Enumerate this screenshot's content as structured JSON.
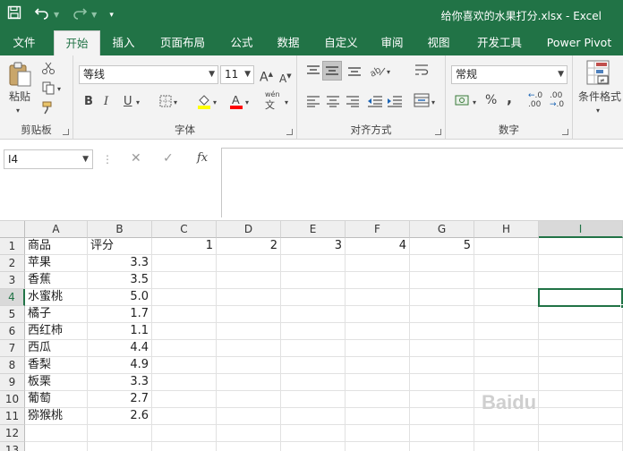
{
  "window": {
    "title": "给你喜欢的水果打分.xlsx - Excel"
  },
  "qat": {
    "save_icon": "save-icon",
    "undo_icon": "undo-icon",
    "redo_icon": "redo-icon",
    "customize_icon": "customize-qat-icon"
  },
  "tabs": [
    "文件",
    "开始",
    "插入",
    "页面布局",
    "公式",
    "数据",
    "审阅",
    "视图",
    "开发工具",
    "Power Pivot"
  ],
  "tabs_extra": "自定义",
  "ribbon": {
    "clipboard": {
      "label": "剪贴板",
      "paste": "粘贴"
    },
    "font": {
      "label": "字体",
      "name": "等线",
      "size": "11",
      "bold": "B",
      "italic": "I",
      "underline": "U",
      "grow": "A",
      "shrink": "A",
      "wen": "wén"
    },
    "alignment": {
      "label": "对齐方式"
    },
    "number": {
      "label": "数字",
      "format": "常规",
      "percent": "%",
      "comma": ",",
      "inc_dec": ".0",
      "dec_dec": ".00"
    },
    "styles": {
      "conditional": "条件格式"
    }
  },
  "formula_bar": {
    "name_box": "I4",
    "fx": "fx",
    "value": ""
  },
  "columns": [
    "A",
    "B",
    "C",
    "D",
    "E",
    "F",
    "G",
    "H",
    "I"
  ],
  "rows": [
    "1",
    "2",
    "3",
    "4",
    "5",
    "6",
    "7",
    "8",
    "9",
    "10",
    "11",
    "12",
    "13"
  ],
  "cells": {
    "A1": "商品",
    "B1": "评分",
    "C1": "1",
    "D1": "2",
    "E1": "3",
    "F1": "4",
    "G1": "5",
    "A2": "苹果",
    "B2": "3.3",
    "A3": "香蕉",
    "B3": "3.5",
    "A4": "水蜜桃",
    "B4": "5.0",
    "A5": "橘子",
    "B5": "1.7",
    "A6": "西红柿",
    "B6": "1.1",
    "A7": "西瓜",
    "B7": "4.4",
    "A8": "香梨",
    "B8": "4.9",
    "A9": "板栗",
    "B9": "3.3",
    "A10": "葡萄",
    "B10": "2.7",
    "A11": "猕猴桃",
    "B11": "2.6"
  },
  "selected_cell": "I4",
  "colors": {
    "accent": "#217346"
  }
}
